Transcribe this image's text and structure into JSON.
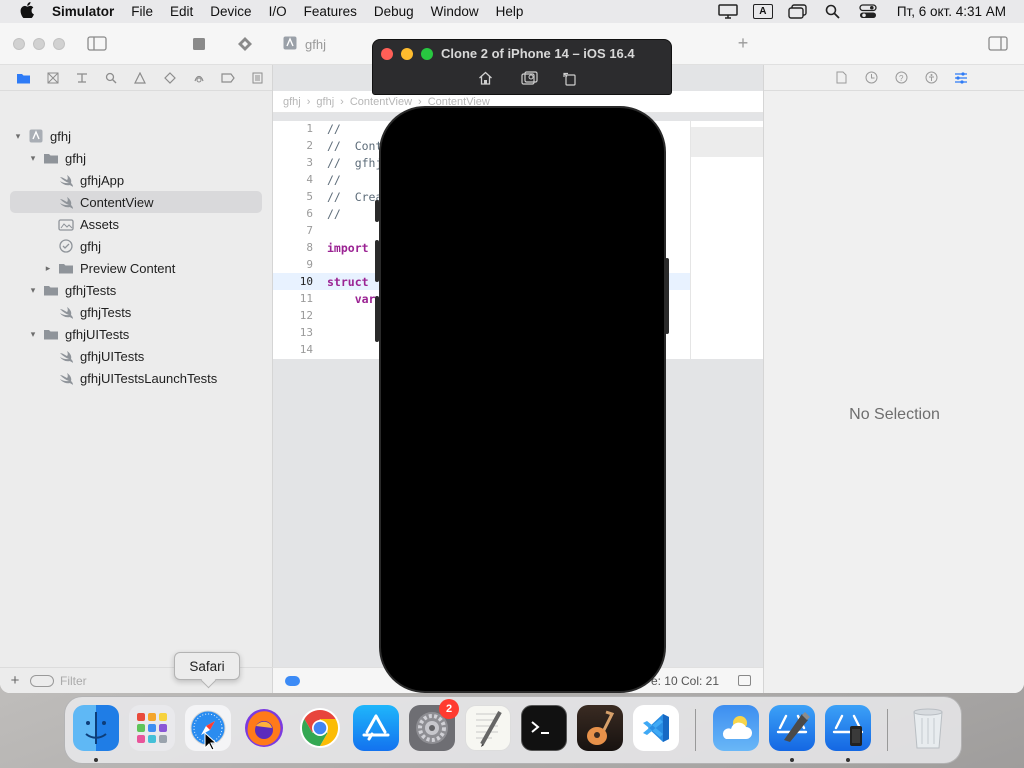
{
  "menubar": {
    "app_name": "Simulator",
    "items": [
      "File",
      "Edit",
      "Device",
      "I/O",
      "Features",
      "Debug",
      "Window",
      "Help"
    ],
    "input_source": "A",
    "clock": "Пт, 6 окт.  4:31 AM"
  },
  "xcode": {
    "tab_title": "gfhj",
    "jumpbar": [
      "gfhj",
      "gfhj",
      "ContentView",
      "ContentView"
    ],
    "navigator": {
      "tree": [
        {
          "label": "gfhj",
          "icon": "project-icon",
          "indent": 0,
          "disclosure": "open"
        },
        {
          "label": "gfhj",
          "icon": "folder-icon",
          "indent": 1,
          "disclosure": "open"
        },
        {
          "label": "gfhjApp",
          "icon": "swift-file-icon",
          "indent": 2,
          "disclosure": "none"
        },
        {
          "label": "ContentView",
          "icon": "swift-file-icon",
          "indent": 2,
          "disclosure": "none",
          "selected": true
        },
        {
          "label": "Assets",
          "icon": "asset-catalog-icon",
          "indent": 2,
          "disclosure": "none"
        },
        {
          "label": "gfhj",
          "icon": "entitlements-icon",
          "indent": 2,
          "disclosure": "none"
        },
        {
          "label": "Preview Content",
          "icon": "folder-icon",
          "indent": 2,
          "disclosure": "closed"
        },
        {
          "label": "gfhjTests",
          "icon": "folder-icon",
          "indent": 1,
          "disclosure": "open"
        },
        {
          "label": "gfhjTests",
          "icon": "swift-file-icon",
          "indent": 2,
          "disclosure": "none"
        },
        {
          "label": "gfhjUITests",
          "icon": "folder-icon",
          "indent": 1,
          "disclosure": "open"
        },
        {
          "label": "gfhjUITests",
          "icon": "swift-file-icon",
          "indent": 2,
          "disclosure": "none"
        },
        {
          "label": "gfhjUITestsLaunchTests",
          "icon": "swift-file-icon",
          "indent": 2,
          "disclosure": "none"
        }
      ],
      "filter_placeholder": "Filter"
    },
    "code": {
      "current_line": 10,
      "lines": [
        {
          "n": "1",
          "text": "//",
          "kind": "comment"
        },
        {
          "n": "2",
          "text": "//  Cont",
          "kind": "comment"
        },
        {
          "n": "3",
          "text": "//  gfhj",
          "kind": "comment"
        },
        {
          "n": "4",
          "text": "//",
          "kind": "comment"
        },
        {
          "n": "5",
          "text": "//  Crea",
          "kind": "comment"
        },
        {
          "n": "6",
          "text": "//",
          "kind": "comment"
        },
        {
          "n": "7",
          "text": "",
          "kind": "plain"
        },
        {
          "n": "8",
          "text": "import",
          "kind": "keyword"
        },
        {
          "n": "9",
          "text": "",
          "kind": "plain"
        },
        {
          "n": "10",
          "text": "struct",
          "kind": "keyword"
        },
        {
          "n": "11",
          "text": "    var",
          "kind": "keyword"
        },
        {
          "n": "12",
          "text": "",
          "kind": "plain"
        },
        {
          "n": "13",
          "text": "",
          "kind": "plain"
        },
        {
          "n": "14",
          "text": "",
          "kind": "plain"
        }
      ]
    },
    "status": {
      "position": "e: 10  Col: 21"
    },
    "inspector": {
      "empty_text": "No Selection"
    }
  },
  "simulator": {
    "title": "Clone 2 of iPhone 14 – iOS 16.4",
    "controls": [
      "home-icon",
      "screenshot-icon",
      "rotate-icon"
    ]
  },
  "tooltip": {
    "text": "Safari"
  },
  "dock": {
    "apps": [
      {
        "name": "finder-icon",
        "running": true
      },
      {
        "name": "launchpad-icon",
        "running": false
      },
      {
        "name": "safari-icon",
        "running": false
      },
      {
        "name": "firefox-icon",
        "running": false
      },
      {
        "name": "chrome-icon",
        "running": false
      },
      {
        "name": "app-store-icon",
        "running": false
      },
      {
        "name": "system-settings-icon",
        "running": false,
        "badge": "2"
      },
      {
        "name": "textedit-icon",
        "running": false
      },
      {
        "name": "terminal-icon",
        "running": false
      },
      {
        "name": "garageband-icon",
        "running": false
      },
      {
        "name": "vscode-icon",
        "running": false
      },
      {
        "name": "weather-icon",
        "running": false
      },
      {
        "name": "xcode-icon",
        "running": true
      },
      {
        "name": "simulator-icon",
        "running": true
      },
      {
        "name": "trash-icon",
        "running": false
      }
    ]
  },
  "colors": {
    "accent": "#2e7bf6",
    "keyword": "#9b2393",
    "badge": "#ff3b30"
  }
}
